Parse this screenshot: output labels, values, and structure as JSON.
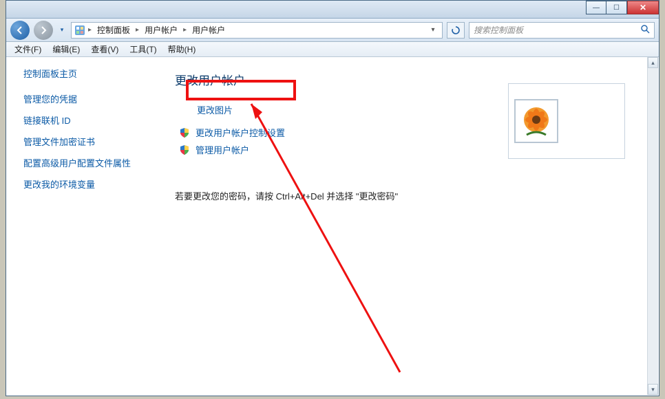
{
  "window_controls": {
    "min": "—",
    "max": "☐",
    "close": "✕"
  },
  "breadcrumb": {
    "items": [
      "控制面板",
      "用户帐户",
      "用户帐户"
    ]
  },
  "search": {
    "placeholder": "搜索控制面板"
  },
  "menubar": {
    "items": [
      "文件(F)",
      "编辑(E)",
      "查看(V)",
      "工具(T)",
      "帮助(H)"
    ]
  },
  "sidebar": {
    "home": "控制面板主页",
    "links": [
      "管理您的凭据",
      "链接联机 ID",
      "管理文件加密证书",
      "配置高级用户配置文件属性",
      "更改我的环境变量"
    ]
  },
  "main": {
    "title": "更改用户帐户",
    "change_picture": "更改图片",
    "uac_link": "更改用户帐户控制设置",
    "manage_accounts": "管理用户帐户",
    "password_note": "若要更改您的密码，请按 Ctrl+Alt+Del 并选择 \"更改密码\""
  }
}
